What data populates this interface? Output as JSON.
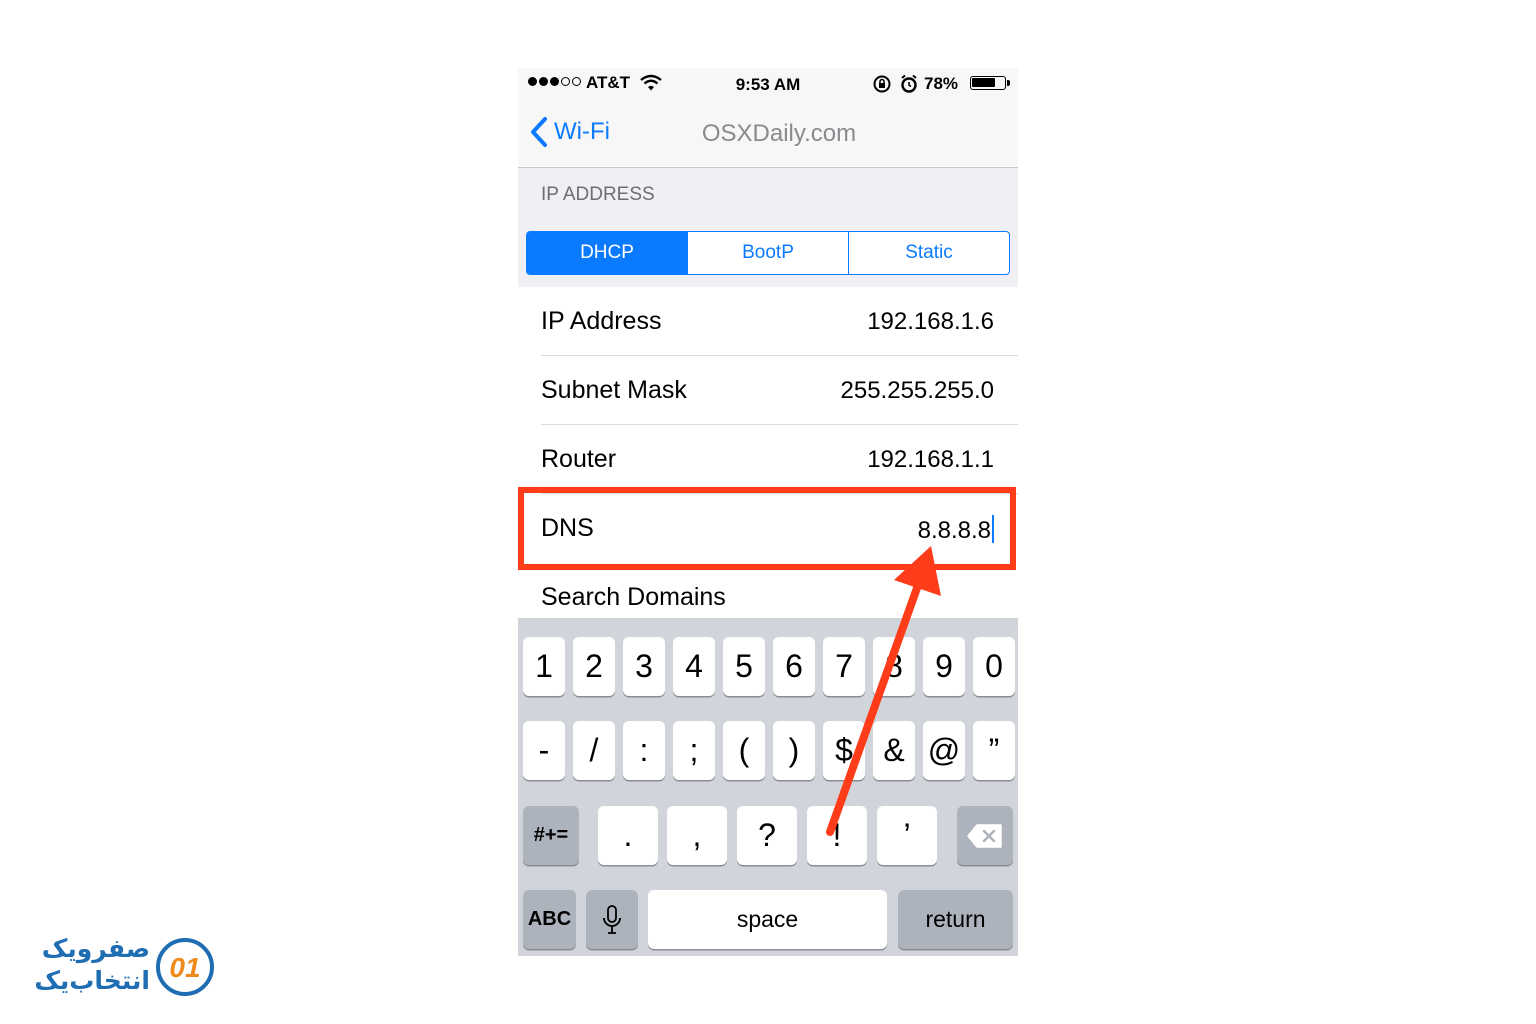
{
  "status_bar": {
    "carrier": "AT&T",
    "time": "9:53 AM",
    "battery_percent": "78%",
    "battery_level": 0.78,
    "signal_bars_filled": 3,
    "signal_bars_total": 5
  },
  "nav": {
    "back_label": "Wi-Fi",
    "title": "OSXDaily.com"
  },
  "section": {
    "header": "IP ADDRESS"
  },
  "segments": [
    {
      "label": "DHCP",
      "selected": true
    },
    {
      "label": "BootP",
      "selected": false
    },
    {
      "label": "Static",
      "selected": false
    }
  ],
  "rows": [
    {
      "label": "IP Address",
      "value": "192.168.1.6"
    },
    {
      "label": "Subnet Mask",
      "value": "255.255.255.0"
    },
    {
      "label": "Router",
      "value": "192.168.1.1"
    },
    {
      "label": "DNS",
      "value": "8.8.8.8"
    },
    {
      "label": "Search Domains",
      "value": ""
    }
  ],
  "keyboard": {
    "row1": [
      "1",
      "2",
      "3",
      "4",
      "5",
      "6",
      "7",
      "8",
      "9",
      "0"
    ],
    "row2": [
      "-",
      "/",
      ":",
      ";",
      "(",
      ")",
      "$",
      "&",
      "@",
      "”"
    ],
    "row3": {
      "shift": "#+=",
      "keys": [
        ".",
        ",",
        "?",
        "!",
        "’"
      ]
    },
    "row4": {
      "abc": "ABC",
      "space": "space",
      "return": "return"
    }
  },
  "colors": {
    "accent": "#0a7aff",
    "highlight": "#ff3c19"
  },
  "watermark": {
    "line1": "صفرویک",
    "line2": "انتخاب‌یک",
    "mark": "01"
  }
}
